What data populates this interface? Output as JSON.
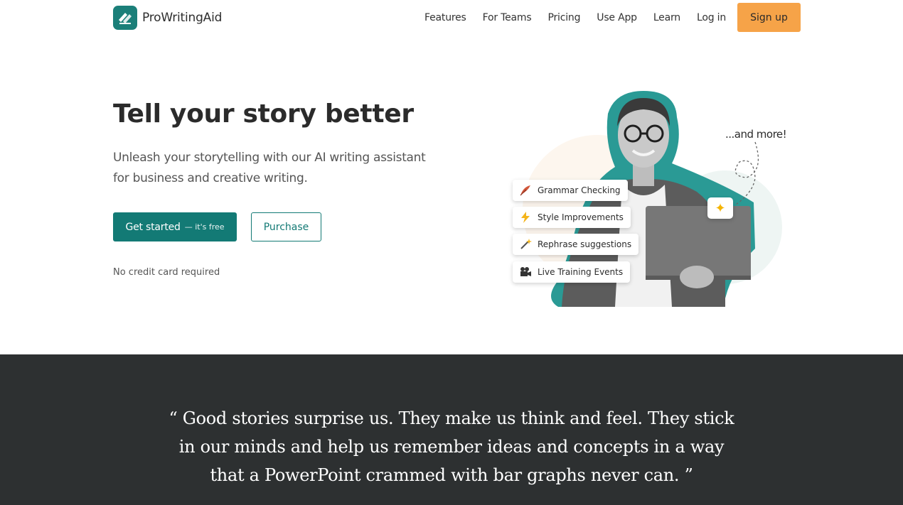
{
  "brand": {
    "name": "ProWritingAid"
  },
  "nav": {
    "links": [
      "Features",
      "For Teams",
      "Pricing",
      "Use App",
      "Learn",
      "Log in"
    ],
    "signup": "Sign up"
  },
  "hero": {
    "title": "Tell your story better",
    "subtitle": "Unleash your storytelling with our AI writing assistant for business and creative writing.",
    "primary_button": {
      "label": "Get started",
      "sublabel": "— it's free"
    },
    "secondary_button": "Purchase",
    "note": "No credit card required"
  },
  "illustration": {
    "features": [
      {
        "label": "Grammar Checking",
        "icon": "feather-icon"
      },
      {
        "label": "Style Improvements",
        "icon": "lightning-icon"
      },
      {
        "label": "Rephrase suggestions",
        "icon": "magic-wand-icon"
      },
      {
        "label": "Live Training Events",
        "icon": "video-camera-icon"
      }
    ],
    "and_more": "...and more!",
    "sparkle_icon": "sparkle-icon"
  },
  "quote": {
    "text": "“ Good stories surprise us. They make us think and feel. They stick in our minds and help us remember ideas and concepts in a way that a PowerPoint crammed with bar graphs never can. ”"
  },
  "colors": {
    "brand_teal": "#137a75",
    "signup_orange": "#f6a348",
    "quote_bg": "#2d3031"
  }
}
